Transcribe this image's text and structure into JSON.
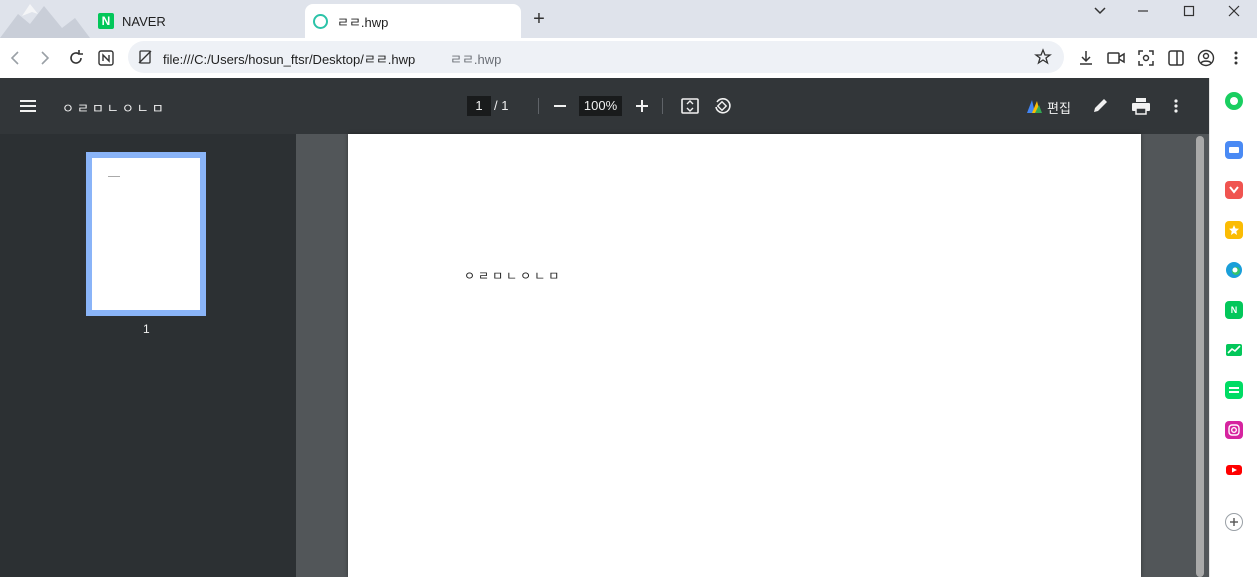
{
  "tabs": [
    {
      "label": "NAVER",
      "favicon": "naver-icon",
      "active": false
    },
    {
      "label": "ㄹㄹ.hwp",
      "favicon": "ring-icon",
      "active": true
    }
  ],
  "address": {
    "url": "file:///C:/Users/hosun_ftsr/Desktop/ㄹㄹ.hwp",
    "suffix": "ㄹㄹ.hwp"
  },
  "pdf": {
    "title": "ㅇㄹㅁㄴㅇㄴㅁ",
    "page_current": "1",
    "page_total": "/  1",
    "zoom": "100%",
    "edit_label": "편집",
    "thumbnail_label": "1",
    "page_text": "ㅇㄹㅁㄴㅇㄴㅁ"
  },
  "colors": {
    "accent": "#8ab4f8",
    "toolbar": "#323639",
    "background": "#525659",
    "naver_green": "#03c75a"
  }
}
